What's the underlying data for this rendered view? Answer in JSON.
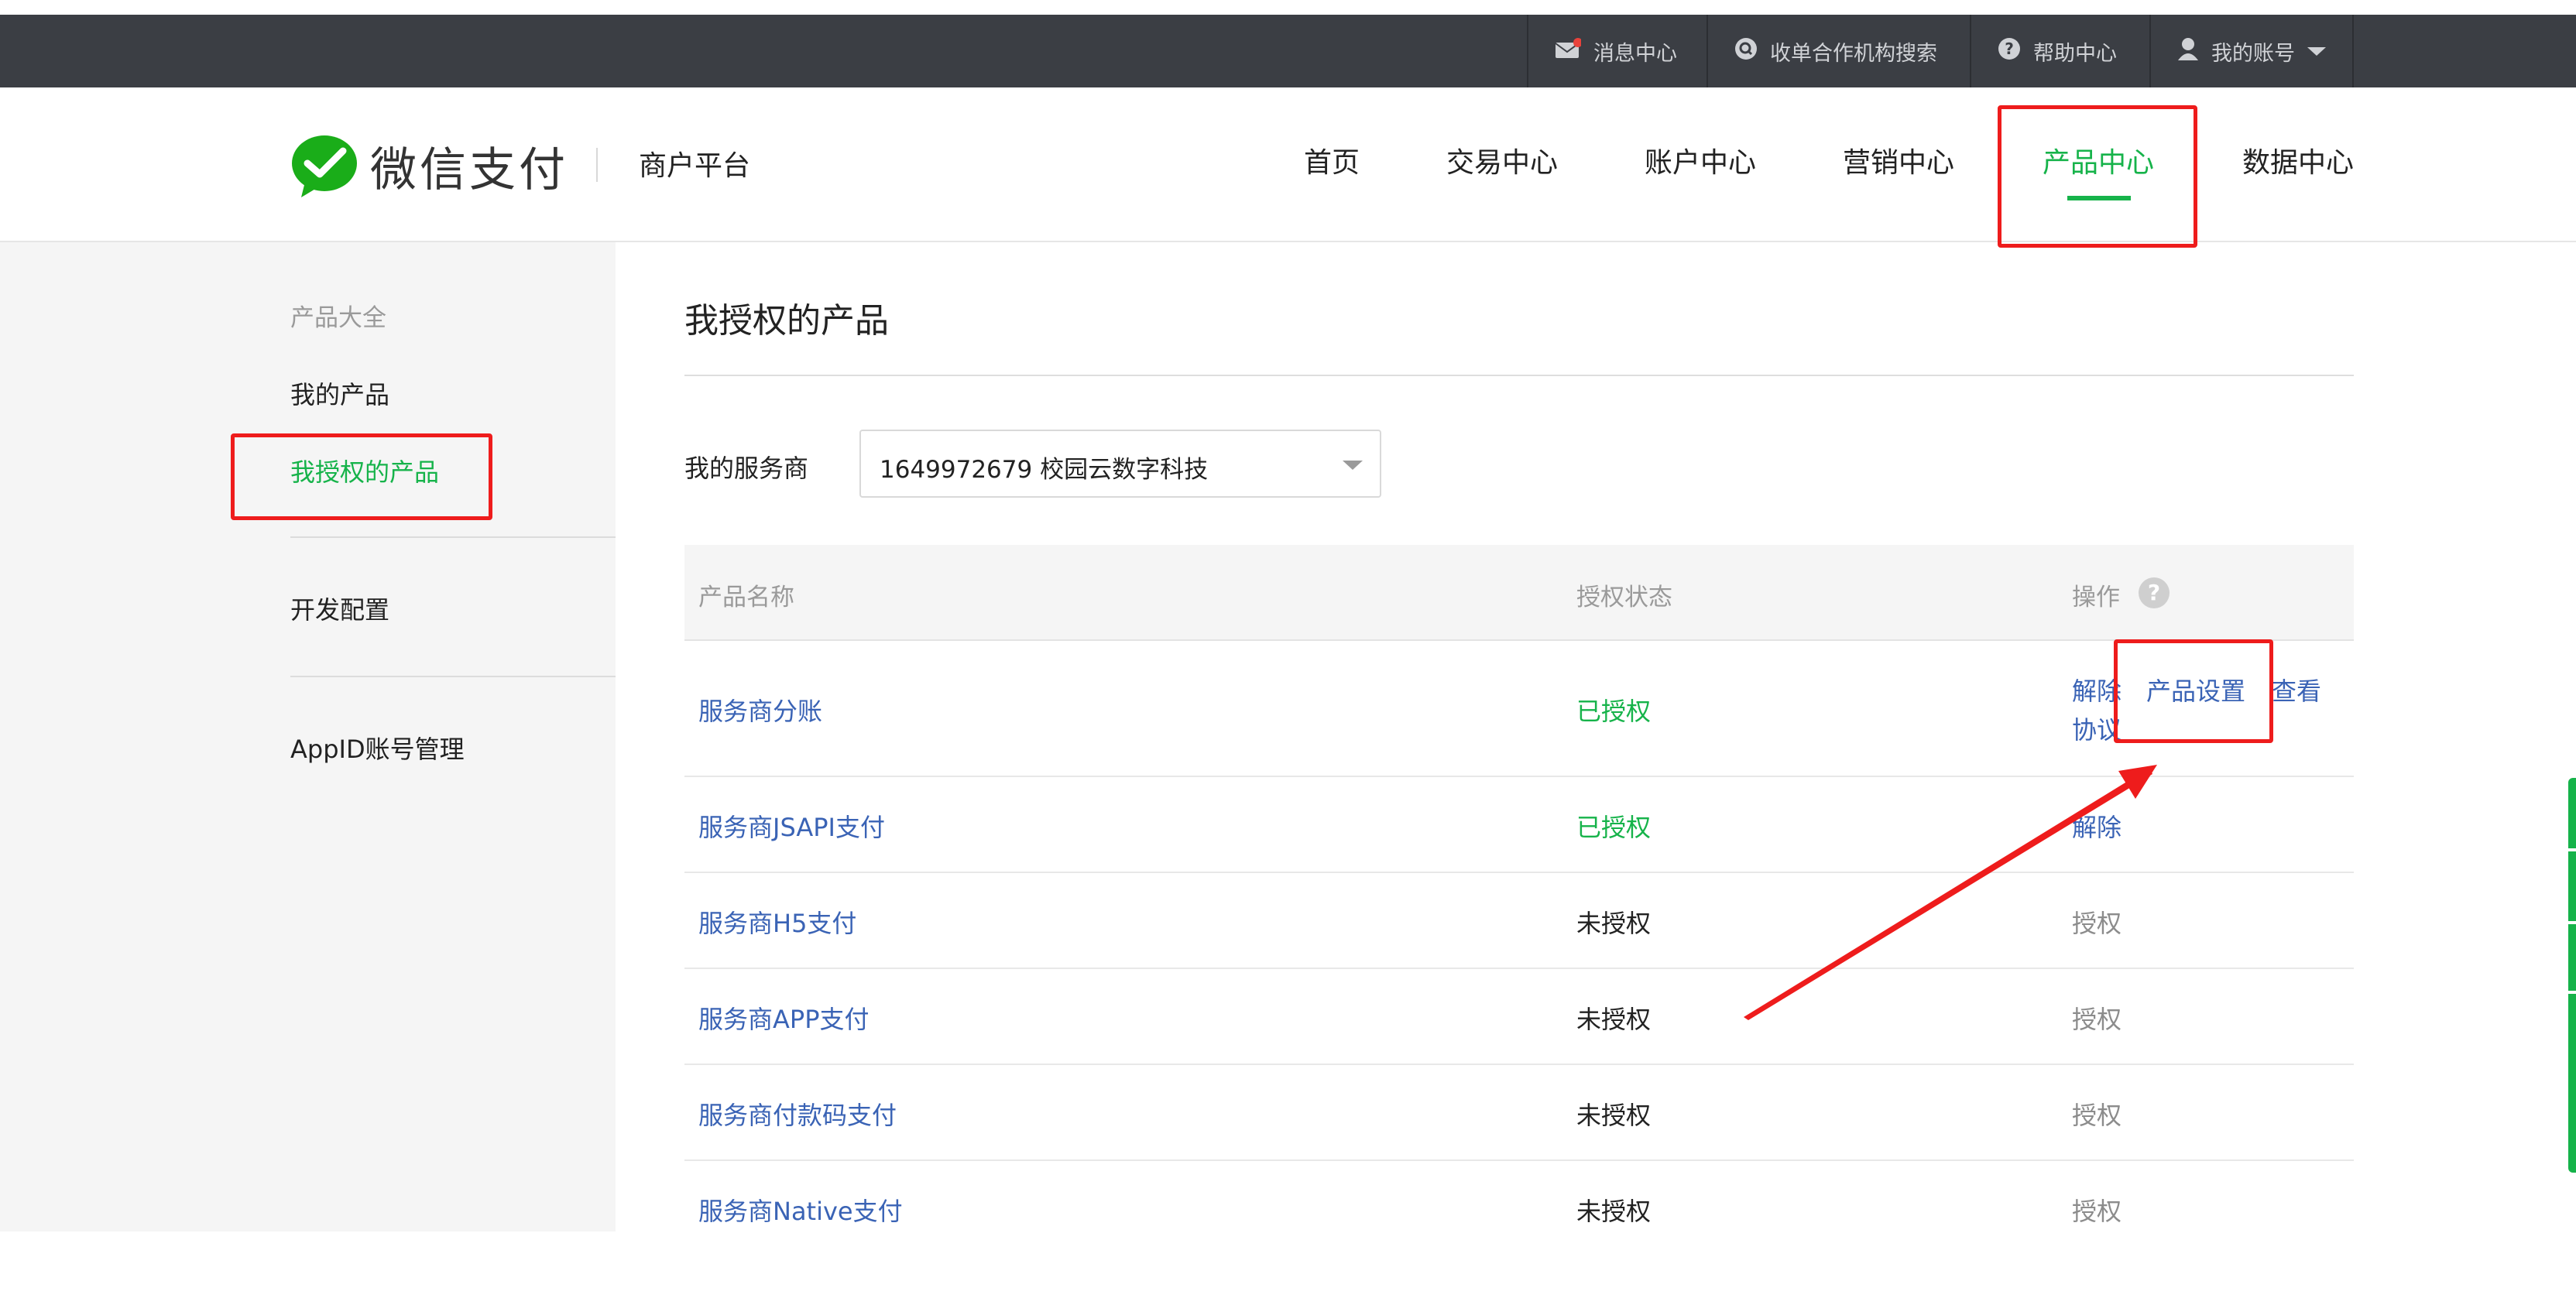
{
  "topbar": {
    "items": [
      {
        "label": "消息中心",
        "icon": "mail-icon"
      },
      {
        "label": "收单合作机构搜索",
        "icon": "search-icon"
      },
      {
        "label": "帮助中心",
        "icon": "help-icon"
      },
      {
        "label": "我的账号",
        "icon": "user-icon"
      }
    ]
  },
  "header": {
    "logo_text": "微信支付",
    "platform": "商户平台",
    "nav": [
      "首页",
      "交易中心",
      "账户中心",
      "营销中心",
      "产品中心",
      "数据中心"
    ],
    "active_nav": "产品中心"
  },
  "sidebar": {
    "group_title": "产品大全",
    "items": [
      "我的产品",
      "我授权的产品",
      "开发配置",
      "AppID账号管理"
    ],
    "active": "我授权的产品"
  },
  "main": {
    "title": "我授权的产品",
    "service_label": "我的服务商",
    "service_value": "1649972679 校园云数字科技",
    "columns": [
      "产品名称",
      "授权状态",
      "操作"
    ],
    "help_mark": "?",
    "rows": [
      {
        "name": "服务商分账",
        "status": "已授权",
        "actions": [
          "解除",
          "产品设置",
          "查看",
          "协议"
        ]
      },
      {
        "name": "服务商JSAPI支付",
        "status": "已授权",
        "actions": [
          "解除"
        ]
      },
      {
        "name": "服务商H5支付",
        "status": "未授权",
        "actions": [
          "授权"
        ]
      },
      {
        "name": "服务商APP支付",
        "status": "未授权",
        "actions": [
          "授权"
        ]
      },
      {
        "name": "服务商付款码支付",
        "status": "未授权",
        "actions": [
          "授权"
        ]
      },
      {
        "name": "服务商Native支付",
        "status": "未授权",
        "actions": [
          "授权"
        ]
      }
    ]
  },
  "colors": {
    "brand_green": "#16b34a",
    "link_blue": "#3a63b5",
    "annotation_red": "#ee1c1c",
    "topbar_bg": "#3b3e44"
  }
}
